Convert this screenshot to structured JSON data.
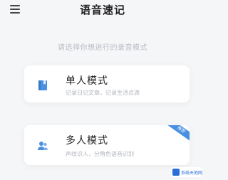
{
  "header": {
    "title": "语音速记",
    "menu_icon": "hamburger-menu-icon"
  },
  "subtitle": "请选择你想进行的录音模式",
  "modes": [
    {
      "title": "单人模式",
      "description": "记录日记文章，记录生活点滴",
      "icon": "book-icon",
      "icon_color": "#4a90e2"
    },
    {
      "title": "多人模式",
      "description": "声纹识人，分角色语音识别",
      "icon": "users-icon",
      "icon_color": "#4a90e2",
      "ribbon_label": "推荐"
    }
  ],
  "watermark": {
    "text": "系统天地网"
  },
  "colors": {
    "accent": "#4a90e2",
    "background": "#f5f6f8",
    "card": "#ffffff"
  }
}
